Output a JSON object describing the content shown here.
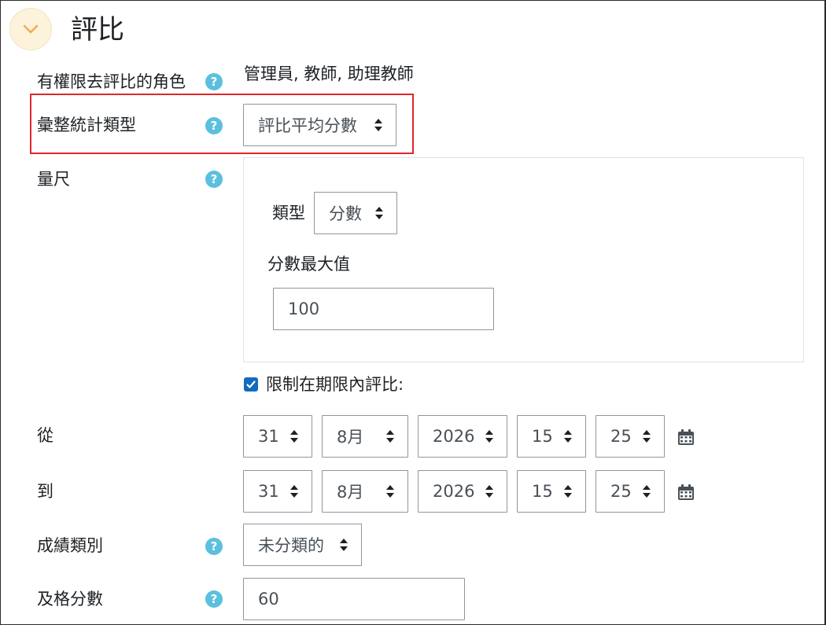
{
  "section": {
    "title": "評比"
  },
  "rows": {
    "roles": {
      "label": "有權限去評比的角色",
      "value": "管理員, 教師, 助理教師"
    },
    "aggregate": {
      "label": "彙整統計類型",
      "value": "評比平均分數"
    },
    "scale": {
      "label": "量尺",
      "type_label": "類型",
      "type_value": "分數",
      "max_label": "分數最大值",
      "max_value": "100"
    },
    "restrict": {
      "label": "限制在期限內評比:",
      "checked": true
    },
    "from": {
      "label": "從",
      "day": "31",
      "month": "8月",
      "year": "2026",
      "hour": "15",
      "minute": "25"
    },
    "to": {
      "label": "到",
      "day": "31",
      "month": "8月",
      "year": "2026",
      "hour": "15",
      "minute": "25"
    },
    "category": {
      "label": "成績類別",
      "value": "未分類的"
    },
    "pass": {
      "label": "及格分數",
      "value": "60"
    }
  },
  "help_icon_text": "?",
  "colors": {
    "accent": "#0f6cbf",
    "help": "#5bc0de",
    "highlight": "#e0262a",
    "collapse_bg": "#fdf3dc",
    "chevron": "#f0ad4e"
  }
}
